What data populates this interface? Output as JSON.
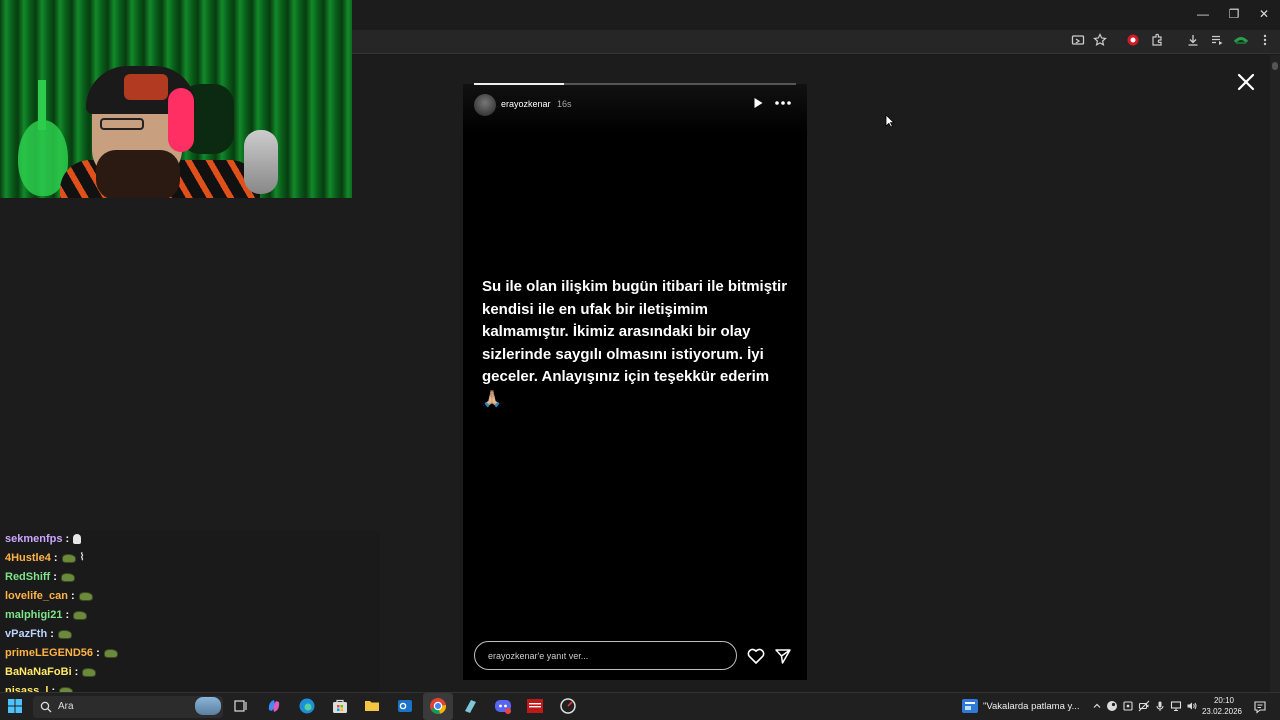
{
  "browser": {
    "window_controls": [
      "—",
      "❐",
      "✕"
    ],
    "toolbar_icons": [
      "cast-icon",
      "star-icon",
      "adblock-icon",
      "extensions-icon",
      "download-icon",
      "media-icon",
      "profile-icon",
      "menu-icon"
    ]
  },
  "story": {
    "username": "erayozkenar",
    "time_ago": "16s",
    "progress": 0.28,
    "text_lines": [
      "Su ile olan ilişkim bugün itibari ile bitmiştir",
      "kendisi ile en ufak bir iletişimim",
      "kalmamıştır. İkimiz arasındaki bir olay",
      "sizlerinde saygılı olmasını istiyorum. İyi",
      "geceler. Anlayışınız için teşekkür ederim"
    ],
    "emoji": "🙏🏼",
    "reply_placeholder": "erayozkenar'e yanıt ver..."
  },
  "chat": {
    "messages": [
      {
        "name": "sekmenfps",
        "color": "#c9a6ff",
        "emotes": [
          "ghost"
        ]
      },
      {
        "name": "4Hustle4",
        "color": "#ffb347",
        "emotes": [
          "tank",
          "snake"
        ]
      },
      {
        "name": "RedShiff",
        "color": "#7ee28a",
        "emotes": [
          "tank"
        ]
      },
      {
        "name": "lovelife_can",
        "color": "#ffb347",
        "emotes": [
          "tank"
        ]
      },
      {
        "name": "malphigi21",
        "color": "#7ee28a",
        "emotes": [
          "tank"
        ]
      },
      {
        "name": "vPazFth",
        "color": "#bcd3ff",
        "emotes": [
          "tank"
        ]
      },
      {
        "name": "primeLEGEND56",
        "color": "#ffb347",
        "emotes": [
          "tank"
        ]
      },
      {
        "name": "BaNaNaFoBi",
        "color": "#ffe866",
        "emotes": [
          "tank"
        ]
      },
      {
        "name": "nisass_l",
        "color": "#ffe866",
        "emotes": [
          "tank"
        ]
      }
    ]
  },
  "taskbar": {
    "search_label": "Ara",
    "news_text": "\"Vakalarda patlama y...",
    "time": "20:10",
    "date": "23.02.2026"
  }
}
